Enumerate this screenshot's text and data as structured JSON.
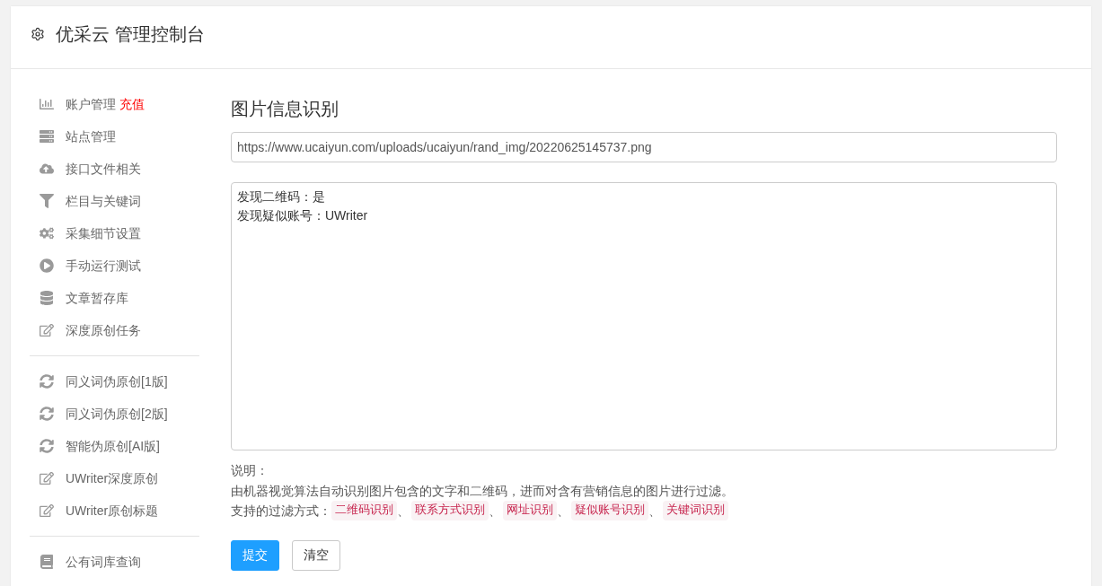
{
  "header": {
    "title": "优采云 管理控制台"
  },
  "sidebar": {
    "groups": [
      {
        "items": [
          {
            "label": "账户管理",
            "badge": "充值"
          },
          {
            "label": "站点管理"
          },
          {
            "label": "接口文件相关"
          },
          {
            "label": "栏目与关键词"
          },
          {
            "label": "采集细节设置"
          },
          {
            "label": "手动运行测试"
          },
          {
            "label": "文章暂存库"
          },
          {
            "label": "深度原创任务"
          }
        ]
      },
      {
        "items": [
          {
            "label": "同义词伪原创[1版]"
          },
          {
            "label": "同义词伪原创[2版]"
          },
          {
            "label": "智能伪原创[AI版]"
          },
          {
            "label": "UWriter深度原创"
          },
          {
            "label": "UWriter原创标题"
          }
        ]
      },
      {
        "items": [
          {
            "label": "公有词库查询"
          }
        ]
      }
    ]
  },
  "main": {
    "title": "图片信息识别",
    "url_field": {
      "value": "https://www.ucaiyun.com/uploads/ucaiyun/rand_img/20220625145737.png"
    },
    "result_field": {
      "lines": [
        "发现二维码：是",
        "发现疑似账号：UWriter"
      ]
    },
    "notes": {
      "heading": "说明：",
      "description": "由机器视觉算法自动识别图片包含的文字和二维码，进而对含有营销信息的图片进行过滤。",
      "filters_label": "支持的过滤方式：",
      "filters": [
        {
          "kind": "tag",
          "text": "二维码识别"
        },
        {
          "kind": "separator",
          "text": "、"
        },
        {
          "kind": "tag",
          "text": "联系方式识别"
        },
        {
          "kind": "separator",
          "text": "、"
        },
        {
          "kind": "tag",
          "text": "网址识别"
        },
        {
          "kind": "separator",
          "text": "、"
        },
        {
          "kind": "tag",
          "text": "疑似账号识别"
        },
        {
          "kind": "separator",
          "text": "、"
        },
        {
          "kind": "tag",
          "text": "关键词识别"
        }
      ]
    },
    "buttons": [
      {
        "label": "提交",
        "kind": "primary"
      },
      {
        "label": "清空",
        "kind": "default"
      }
    ]
  }
}
